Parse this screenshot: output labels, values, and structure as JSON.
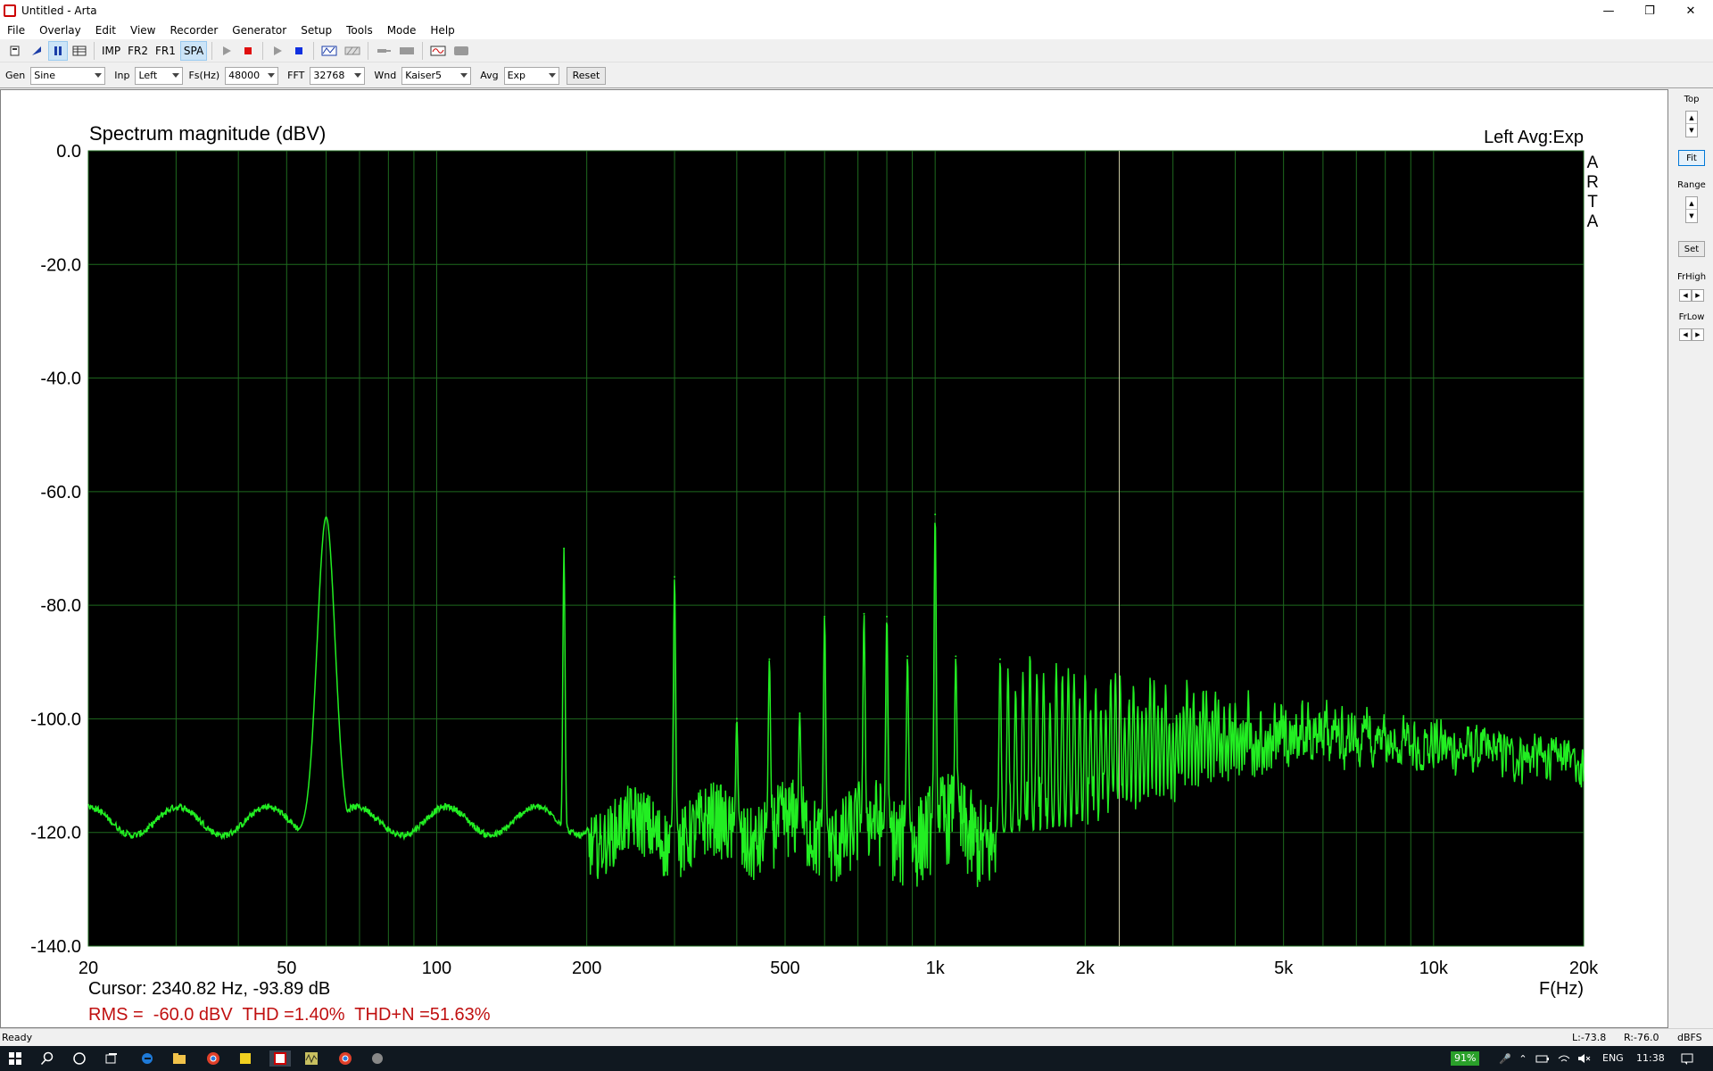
{
  "window": {
    "title": "Untitled - Arta"
  },
  "menu": [
    "File",
    "Overlay",
    "Edit",
    "View",
    "Recorder",
    "Generator",
    "Setup",
    "Tools",
    "Mode",
    "Help"
  ],
  "toolbar": {
    "imp": "IMP",
    "fr2": "FR2",
    "fr1": "FR1",
    "spa": "SPA"
  },
  "params": {
    "gen_label": "Gen",
    "gen_value": "Sine",
    "inp_label": "Inp",
    "inp_value": "Left",
    "fs_label": "Fs(Hz)",
    "fs_value": "48000",
    "fft_label": "FFT",
    "fft_value": "32768",
    "wnd_label": "Wnd",
    "wnd_value": "Kaiser5",
    "avg_label": "Avg",
    "avg_value": "Exp",
    "reset_label": "Reset"
  },
  "plot": {
    "cursor_text": "Cursor: 2340.82 Hz, -93.89 dB",
    "measurements": "RMS =  -60.0 dBV  THD =1.40%  THD+N =51.63%",
    "corner_label": "Left  Avg:Exp",
    "arta_letters": [
      "A",
      "R",
      "T",
      "A"
    ]
  },
  "chart_data": {
    "type": "line",
    "title": "Spectrum magnitude (dBV)",
    "xlabel": "F(Hz)",
    "ylabel": "",
    "x_scale": "log",
    "xlim": [
      20,
      20000
    ],
    "ylim": [
      -140,
      0
    ],
    "grid": true,
    "x_ticks": [
      20,
      50,
      100,
      200,
      500,
      1000,
      2000,
      5000,
      10000,
      20000
    ],
    "x_tick_labels": [
      "20",
      "50",
      "100",
      "200",
      "500",
      "1k",
      "2k",
      "5k",
      "10k",
      "20k"
    ],
    "y_ticks": [
      0,
      -20,
      -40,
      -60,
      -80,
      -100,
      -120,
      -140
    ],
    "y_tick_labels": [
      "0.0",
      "-20.0",
      "-40.0",
      "-60.0",
      "-80.0",
      "-100.0",
      "-120.0",
      "-140.0"
    ],
    "cursor_x": 2340.82,
    "noise_floor_db": -120,
    "peaks": [
      {
        "f": 60,
        "db": -64.5
      },
      {
        "f": 180,
        "db": -70
      },
      {
        "f": 300,
        "db": -75
      },
      {
        "f": 400,
        "db": -100
      },
      {
        "f": 465,
        "db": -89.5
      },
      {
        "f": 535,
        "db": -99
      },
      {
        "f": 600,
        "db": -82
      },
      {
        "f": 720,
        "db": -81.5
      },
      {
        "f": 800,
        "db": -82
      },
      {
        "f": 880,
        "db": -89
      },
      {
        "f": 1000,
        "db": -64
      },
      {
        "f": 1100,
        "db": -89
      },
      {
        "f": 1350,
        "db": -89.5
      }
    ],
    "series": [
      {
        "color": "#22ee22"
      }
    ],
    "colors": {
      "background": "#000000",
      "grid": "#1e6a1e",
      "trace": "#22ee22",
      "cursor": "#c8c8a0"
    }
  },
  "right_panel": {
    "top": "Top",
    "fit": "Fit",
    "range": "Range",
    "set": "Set",
    "frhigh": "FrHigh",
    "frlow": "FrLow"
  },
  "status": {
    "left": "Ready",
    "l_level": "L:-73.8",
    "r_level": "R:-76.0",
    "units": "dBFS"
  },
  "taskbar": {
    "battery": "91%",
    "lang": "ENG",
    "time": "11:38"
  }
}
